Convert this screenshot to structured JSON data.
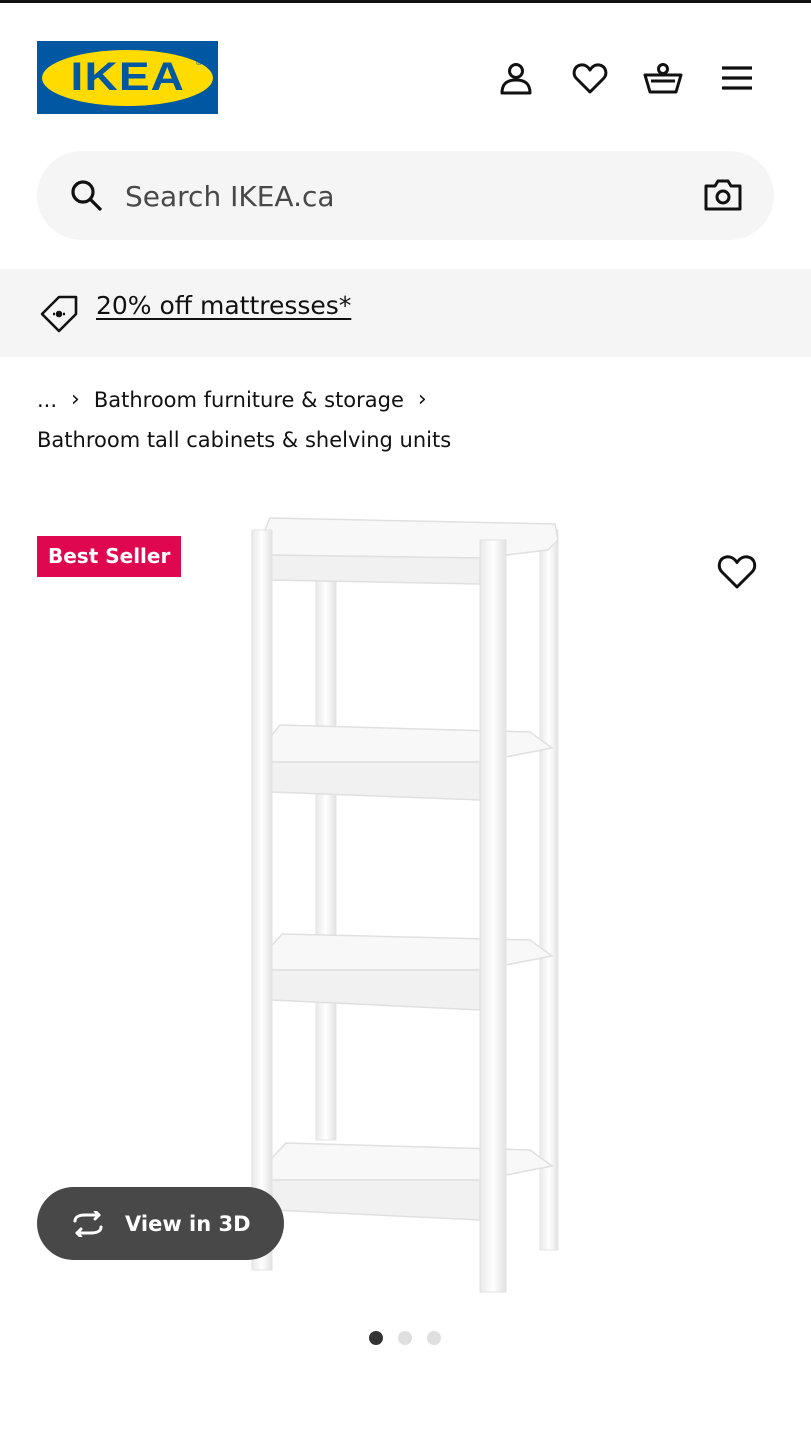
{
  "header": {
    "logo_text": "IKEA",
    "logo_mark": "®",
    "icons": [
      "account-icon",
      "heart-icon",
      "basket-icon",
      "menu-icon"
    ]
  },
  "search": {
    "placeholder": "Search IKEA.ca",
    "icon": "search-icon",
    "visual_search_icon": "camera-icon"
  },
  "promo": {
    "icon": "price-tag-icon",
    "link_text": "20% off mattresses*"
  },
  "breadcrumb": {
    "ellipsis": "...",
    "separator": "›",
    "parent": "Bathroom furniture & storage",
    "current": "Bathroom tall cabinets & shelving units"
  },
  "product": {
    "badge": "Best Seller",
    "view_3d_label": "View in 3D",
    "image_count": 3,
    "active_image_index": 0
  },
  "colors": {
    "ikea_blue": "#0058a3",
    "ikea_yellow": "#ffdb00",
    "badge_red": "#e00751",
    "surface_grey": "#f5f5f5",
    "pill_dark": "#484848"
  }
}
